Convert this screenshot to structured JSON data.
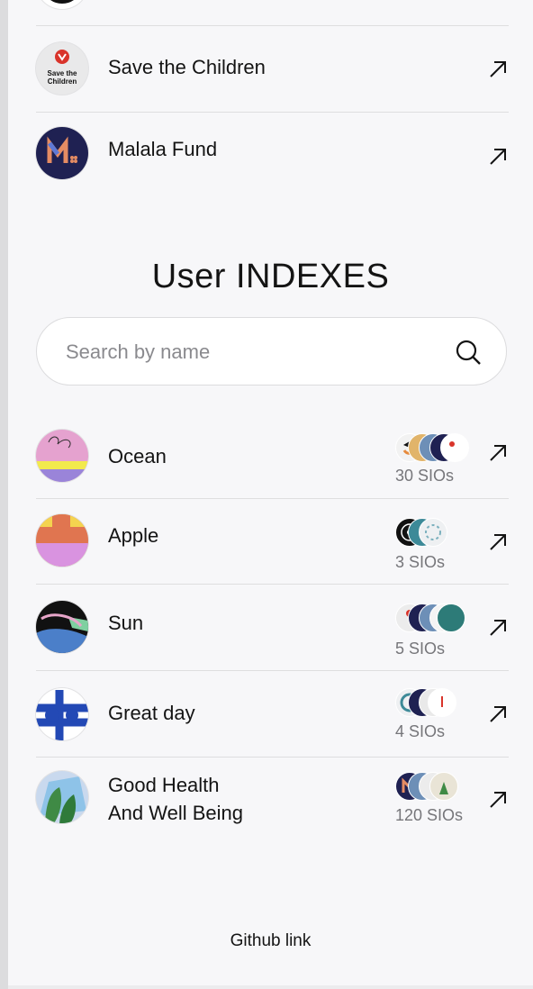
{
  "organizations": [
    {
      "name": "Save the Children",
      "logo_text_1": "Save the",
      "logo_text_2": "Children"
    },
    {
      "name": "Malala Fund"
    }
  ],
  "section": {
    "title": "User INDEXES"
  },
  "search": {
    "placeholder": "Search by name",
    "value": ""
  },
  "indexes": [
    {
      "name": "Ocean",
      "sio_count": "30 SIOs"
    },
    {
      "name": "Apple",
      "sio_count": "3 SIOs"
    },
    {
      "name": "Sun",
      "sio_count": "5 SIOs"
    },
    {
      "name": "Great day",
      "sio_count": "4 SIOs"
    },
    {
      "name_line1": "Good Health",
      "name_line2": "And Well Being",
      "sio_count": "120 SIOs"
    }
  ],
  "footer": {
    "github_label": "Github link"
  },
  "icons": {
    "arrow": "arrow-up-right-icon",
    "search": "search-icon"
  },
  "colors": {
    "background": "#f7f7f9",
    "text": "#141414",
    "muted": "#76767a",
    "divider": "#dededf"
  }
}
